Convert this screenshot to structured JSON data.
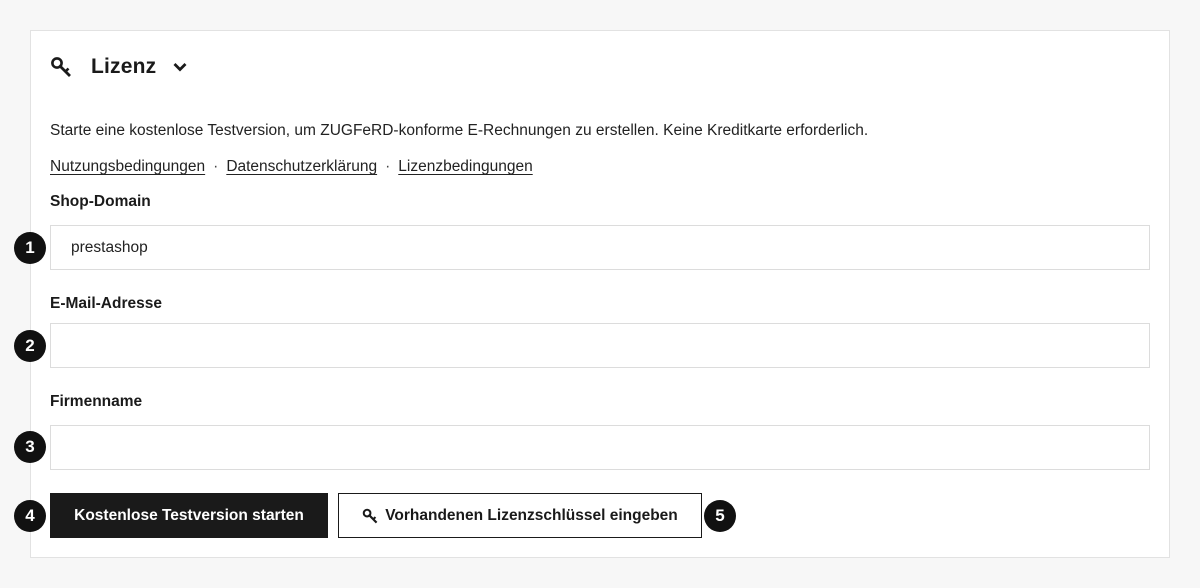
{
  "header": {
    "title": "Lizenz",
    "icon": "key-icon",
    "toggle_icon": "chevron-down-icon"
  },
  "intro": "Starte eine kostenlose Testversion, um ZUGFeRD-konforme E-Rechnungen zu erstellen. Keine Kreditkarte erforderlich.",
  "links": {
    "terms": "Nutzungsbedingungen",
    "privacy": "Datenschutzerklärung",
    "license": "Lizenzbedingungen",
    "separator": "·"
  },
  "form": {
    "shop_domain": {
      "label": "Shop-Domain",
      "value": "prestashop",
      "badge": "1"
    },
    "email": {
      "label": "E-Mail-Adresse",
      "value": "",
      "badge": "2"
    },
    "company": {
      "label": "Firmenname",
      "value": "",
      "badge": "3"
    }
  },
  "actions": {
    "start_trial": {
      "label": "Kostenlose Testversion starten",
      "badge": "4"
    },
    "enter_key": {
      "label": "Vorhandenen Lizenzschlüssel eingeben",
      "badge": "5",
      "icon": "key-icon"
    }
  },
  "colors": {
    "primary_button": "#1a1a1a",
    "badge": "#111111",
    "border": "#dcdcdc"
  }
}
